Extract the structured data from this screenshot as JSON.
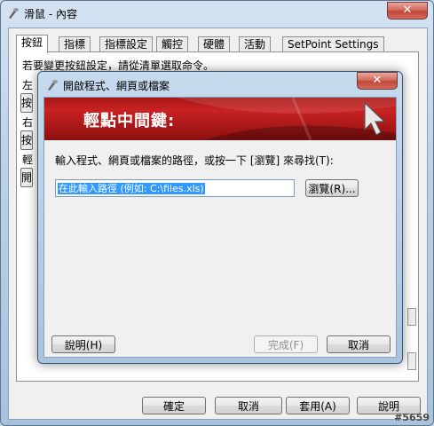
{
  "window": {
    "title": "滑鼠 - 內容",
    "close": "✕",
    "tabs": [
      "按鈕",
      "指標",
      "指標設定",
      "觸控",
      "硬體",
      "活動",
      "SetPoint Settings"
    ],
    "instruction": "若要變更按鈕設定，請從清單選取命令。",
    "side_labels": [
      "左",
      "右",
      "輕"
    ],
    "side_buttons": [
      "按",
      "按",
      "開"
    ],
    "buttons": {
      "ok": "確定",
      "cancel": "取消",
      "apply": "套用(A)",
      "help": "說明"
    }
  },
  "dialog": {
    "title": "開啟程式、網頁或檔案",
    "close": "✕",
    "banner": "輕點中間鍵:",
    "prompt": "輸入程式、網頁或檔案的路徑，或按一下 [瀏覽] 來尋找(T):",
    "path_value": "在此輸入路徑 (例如: C:\\files.xls)",
    "buttons": {
      "browse": "瀏覽(R)...",
      "help": "說明(H)",
      "finish": "完成(F)",
      "cancel": "取消"
    }
  },
  "watermark": "#5659"
}
